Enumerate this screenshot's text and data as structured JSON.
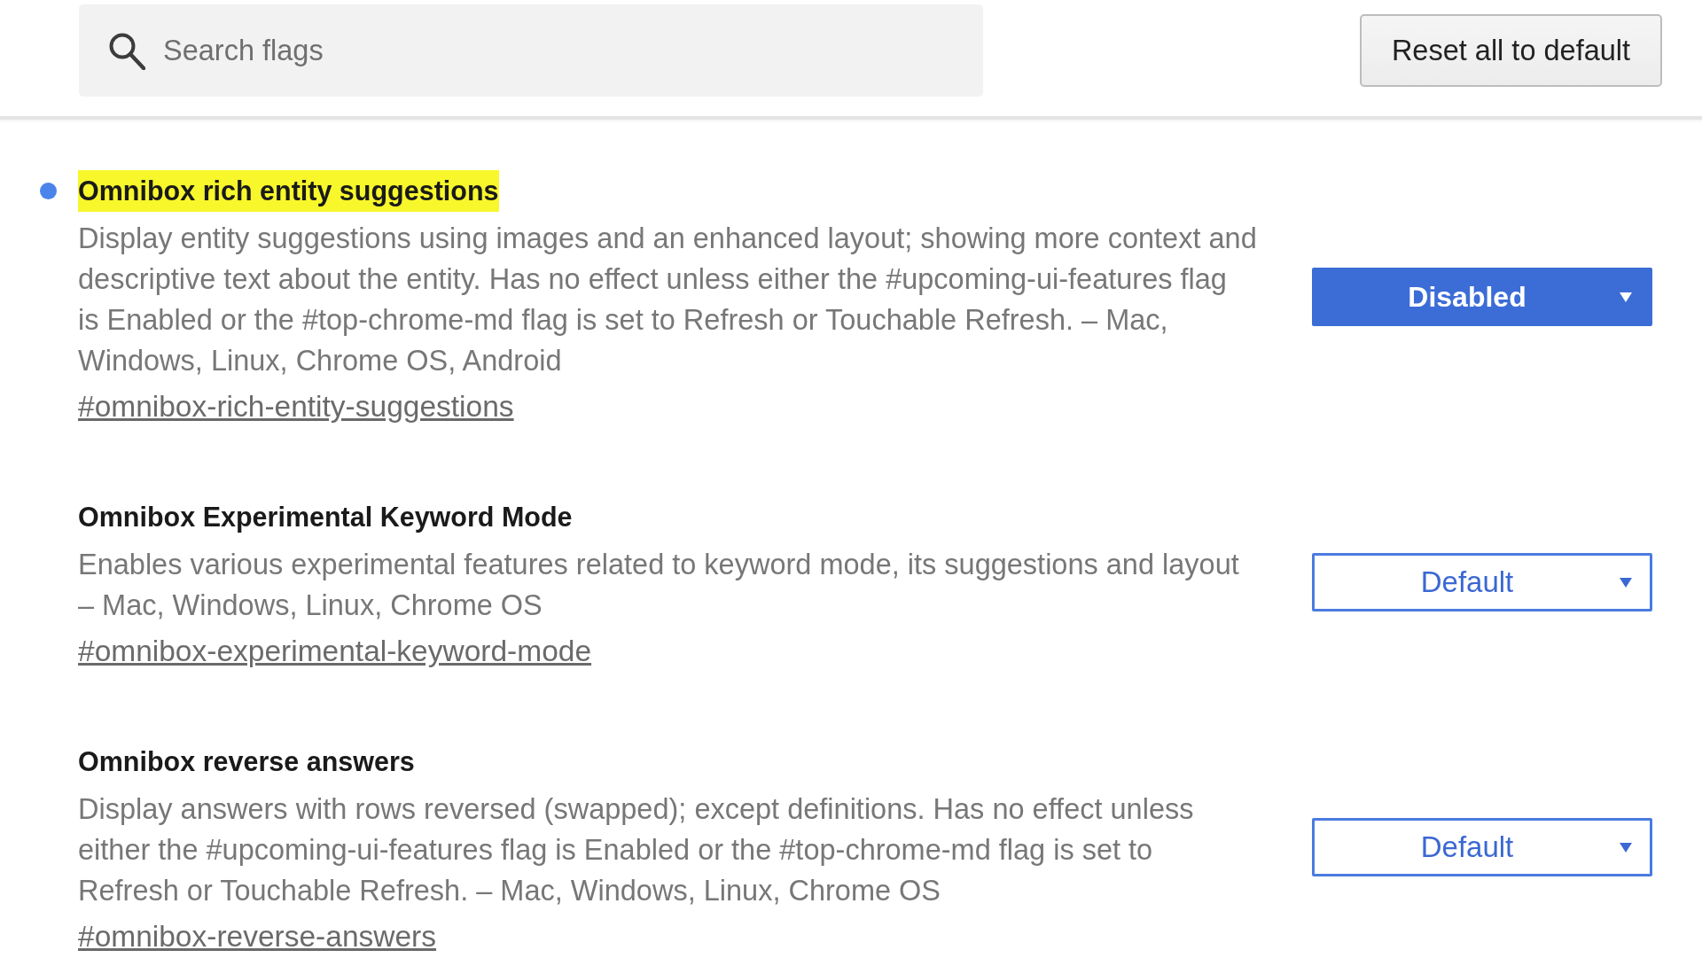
{
  "search": {
    "placeholder": "Search flags"
  },
  "reset_button": "Reset all to default",
  "flags": [
    {
      "title": "Omnibox rich entity suggestions",
      "highlighted": true,
      "modified": true,
      "description": "Display entity suggestions using images and an enhanced layout; showing more context and\ndescriptive text about the entity. Has no effect unless either the #upcoming-ui-features flag\nis Enabled or the #top-chrome-md flag is set to Refresh or Touchable Refresh. – Mac,\nWindows, Linux, Chrome OS, Android",
      "link": "#omnibox-rich-entity-suggestions",
      "value": "Disabled"
    },
    {
      "title": "Omnibox Experimental Keyword Mode",
      "highlighted": false,
      "modified": false,
      "description": "Enables various experimental features related to keyword mode, its suggestions and layout\n– Mac, Windows, Linux, Chrome OS",
      "link": "#omnibox-experimental-keyword-mode",
      "value": "Default"
    },
    {
      "title": "Omnibox reverse answers",
      "highlighted": false,
      "modified": false,
      "description": "Display answers with rows reversed (swapped); except definitions. Has no effect unless\neither the #upcoming-ui-features flag is Enabled or the #top-chrome-md flag is set to\nRefresh or Touchable Refresh. – Mac, Windows, Linux, Chrome OS",
      "link": "#omnibox-reverse-answers",
      "value": "Default"
    }
  ]
}
